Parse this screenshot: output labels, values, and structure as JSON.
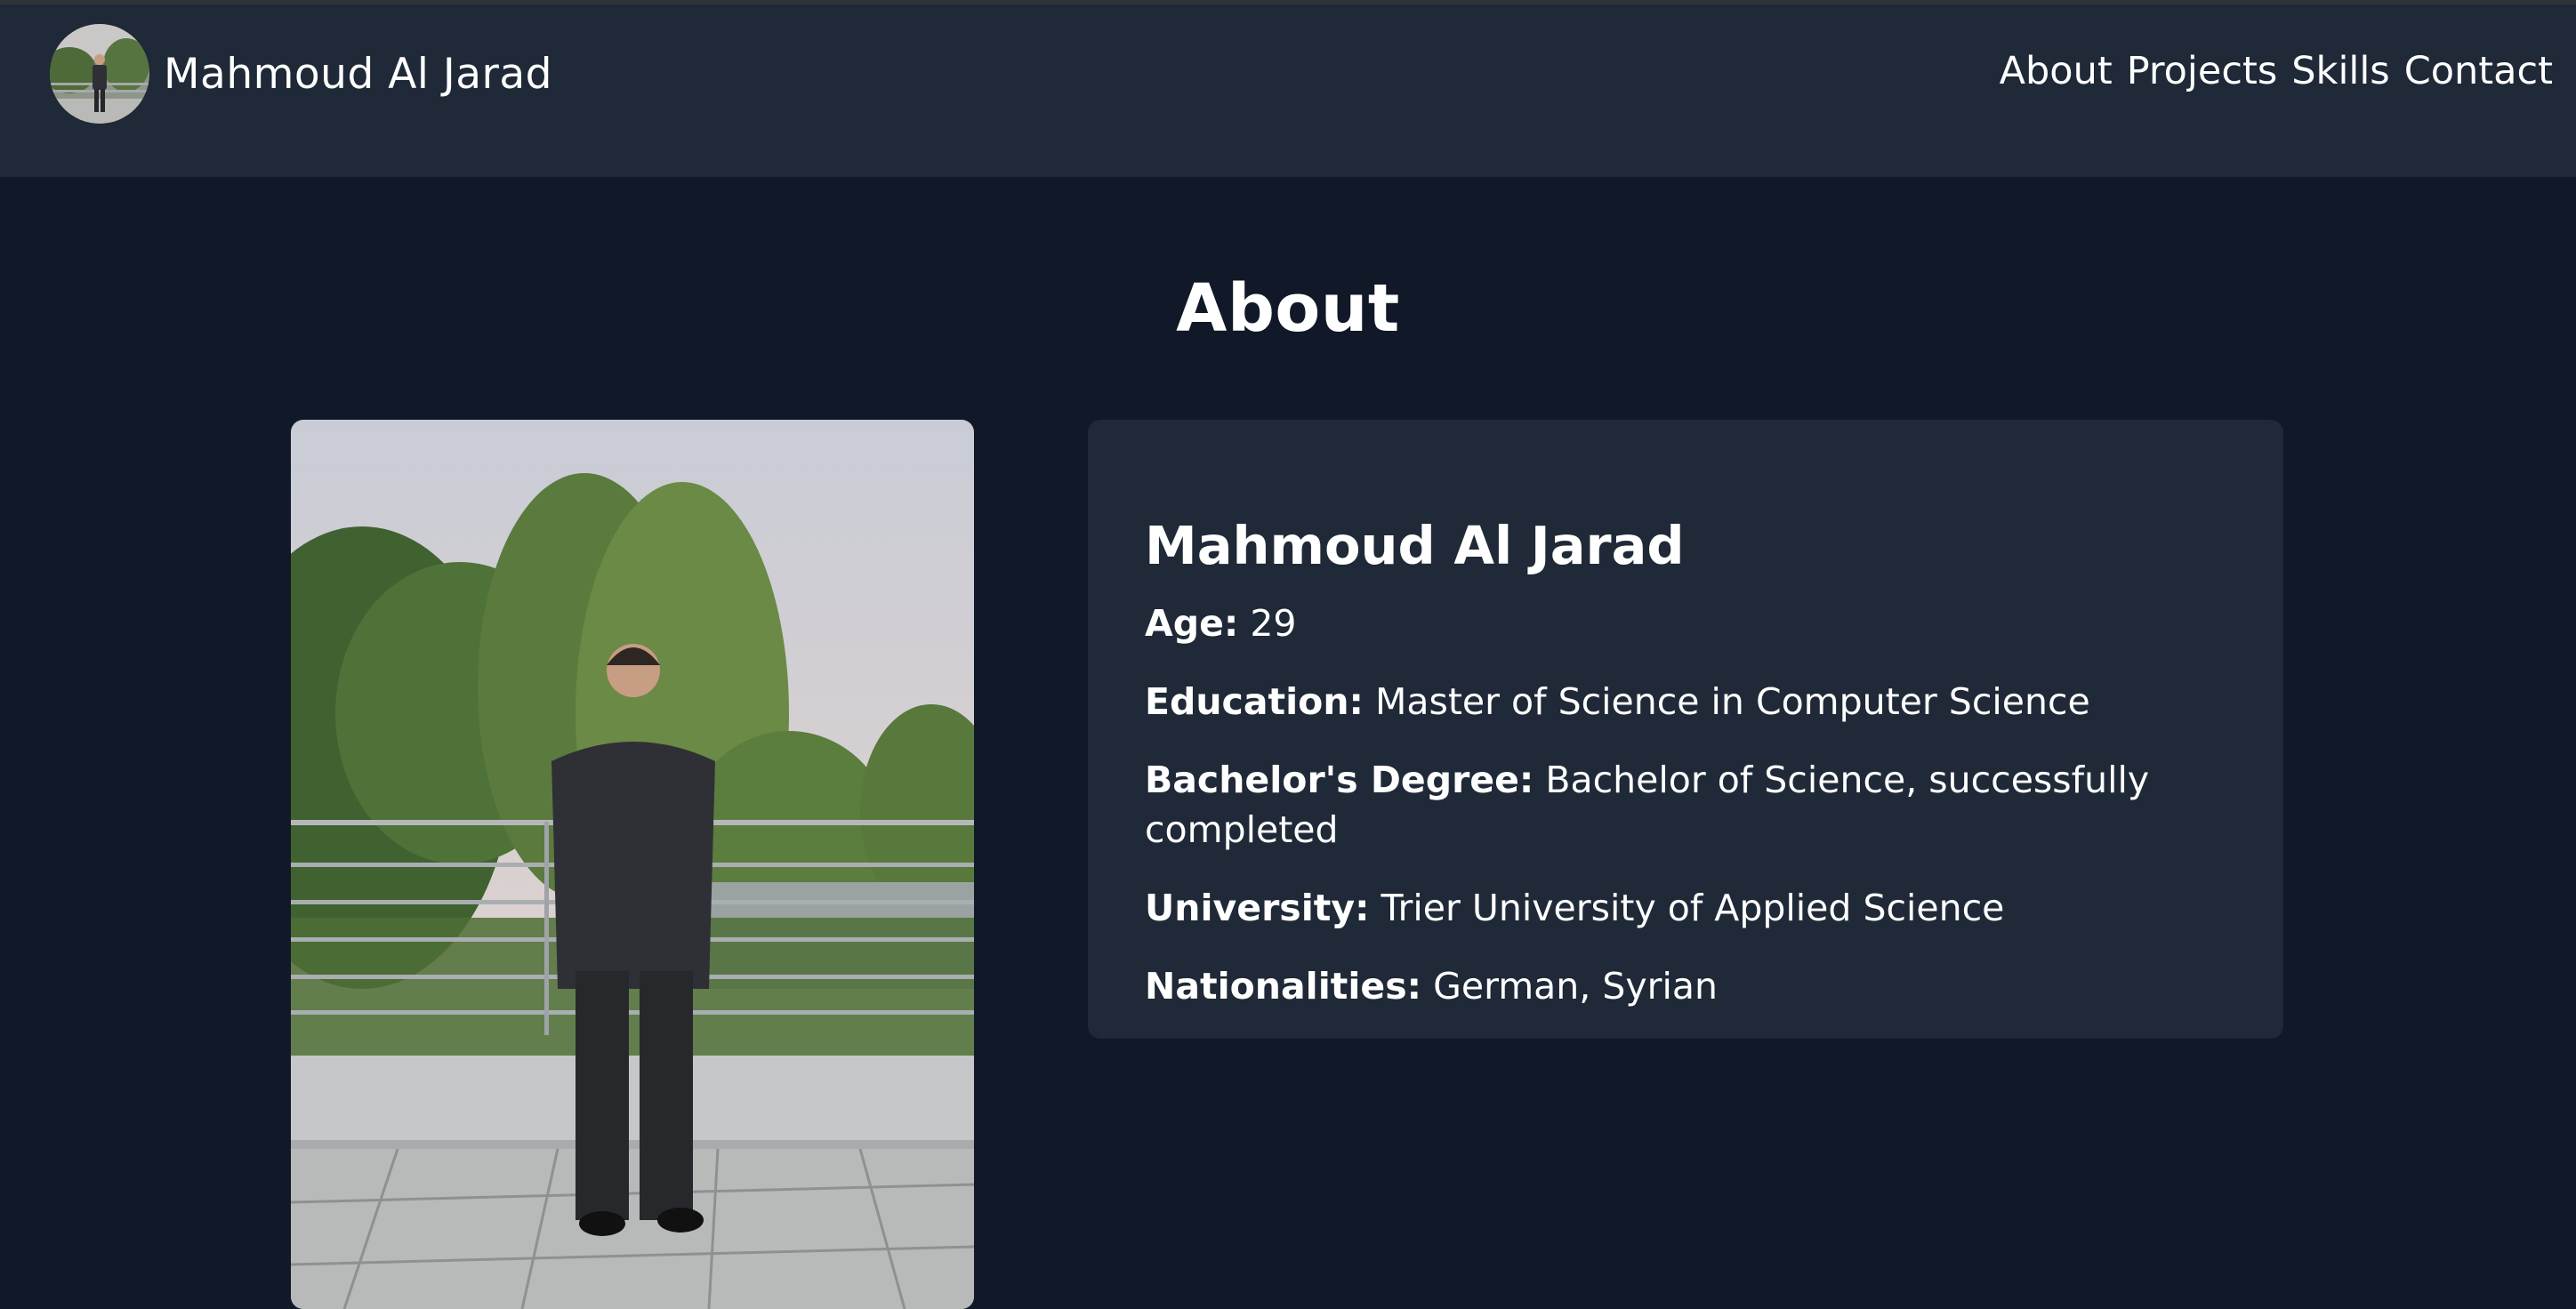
{
  "header": {
    "brand_name": "Mahmoud Al Jarad",
    "nav": [
      {
        "label": "About"
      },
      {
        "label": "Projects"
      },
      {
        "label": "Skills"
      },
      {
        "label": "Contact"
      }
    ]
  },
  "about": {
    "section_title": "About",
    "name": "Mahmoud Al Jarad",
    "facts": [
      {
        "label": "Age:",
        "value": "29"
      },
      {
        "label": "Education:",
        "value": "Master of Science in Computer Science"
      },
      {
        "label": "Bachelor's Degree:",
        "value": "Bachelor of Science, successfully completed"
      },
      {
        "label": "University:",
        "value": "Trier University of Applied Science"
      },
      {
        "label": "Nationalities:",
        "value": "German, Syrian"
      }
    ]
  },
  "colors": {
    "page_bg": "#111827",
    "nav_bg": "#1f2937",
    "card_bg": "#1f2937",
    "text": "#ffffff"
  }
}
